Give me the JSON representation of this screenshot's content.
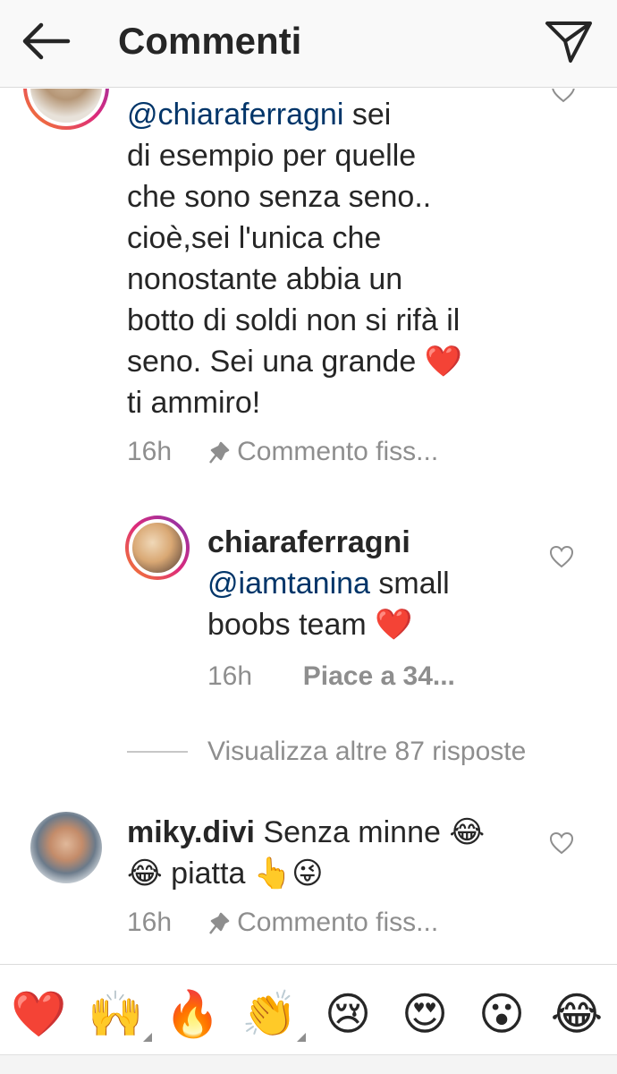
{
  "header": {
    "title": "Commenti"
  },
  "comments": [
    {
      "mention": "@chiaraferragni",
      "lines": [
        " sei",
        "di esempio per quelle",
        "che sono senza seno..",
        "cioè,sei l'unica che",
        "nonostante abbia un",
        "botto di soldi non si rifà il",
        "seno. Sei una grande ❤️",
        "ti ammiro!"
      ],
      "time": "16h",
      "pinned": "Commento fiss..."
    },
    {
      "username": "chiaraferragni",
      "mention": "@iamtanina",
      "line1_rest": " small",
      "line2": "boobs team ❤️",
      "time": "16h",
      "likes": "Piace a 34..."
    },
    {
      "view_more": "Visualizza altre 87 risposte"
    },
    {
      "username": "miky.divi",
      "line1_rest": " Senza minne 😂",
      "line2": "😂 piatta 👆😜",
      "time": "16h",
      "pinned": "Commento fiss..."
    }
  ],
  "emoji_bar": [
    "❤️",
    "🙌",
    "🔥",
    "👏",
    "😢",
    "😍",
    "😮",
    "😂"
  ]
}
